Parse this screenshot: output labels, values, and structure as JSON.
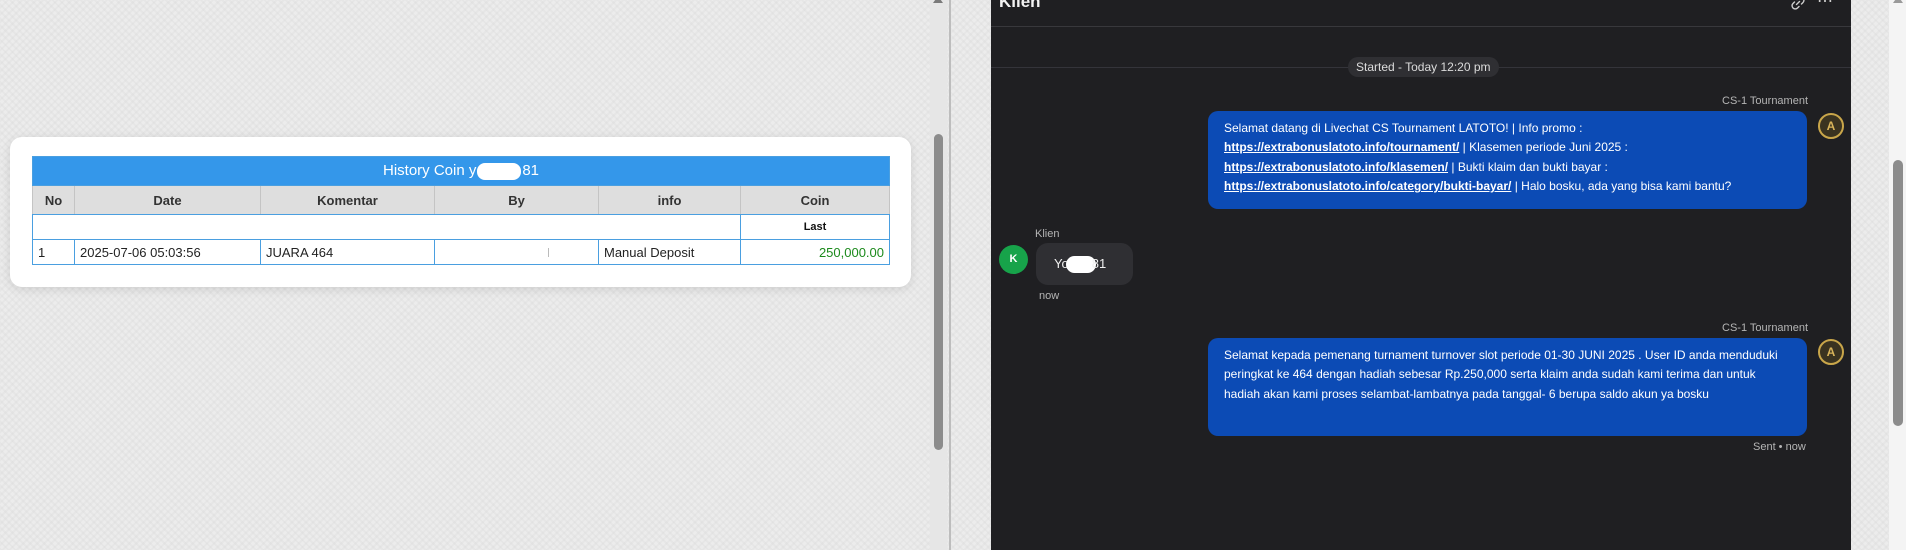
{
  "history": {
    "title_prefix": "History Coin y",
    "title_suffix": "81",
    "columns": [
      "No",
      "Date",
      "Komentar",
      "By",
      "info",
      "Coin"
    ],
    "last_label": "Last",
    "rows": [
      {
        "no": "1",
        "date": "2025-07-06 05:03:56",
        "komentar": "JUARA 464",
        "by": "",
        "info": "Manual Deposit",
        "coin": "250,000.00"
      }
    ]
  },
  "chat": {
    "title": "Klien",
    "started": "Started - Today 12:20 pm",
    "messages": [
      {
        "sender": "CS-1 Tournament",
        "avatar": "A",
        "p1": "Selamat datang di Livechat CS Tournament LATOTO! | Info promo :",
        "link1": "https://extrabonuslatoto.info/tournament/",
        "p2": " | Klasemen periode Juni 2025 :",
        "link2": "https://extrabonuslatoto.info/klasemen/",
        "p3": " | Bukti klaim dan bukti bayar :",
        "link3": "https://extrabonuslatoto.info/category/bukti-bayar/",
        "p4": " | Halo bosku, ada yang bisa kami bantu?"
      },
      {
        "sender": "CS-1 Tournament",
        "avatar": "A",
        "text": "Selamat kepada pemenang turnament turnover slot periode 01-30 JUNI 2025 . User ID anda menduduki peringkat ke 464 dengan hadiah sebesar Rp.250,000 serta klaim anda sudah kami terima dan untuk hadiah akan kami proses selambat-lambatnya pada tanggal- 6 berupa saldo akun ya bosku",
        "status": "Sent • now"
      }
    ],
    "client": {
      "name": "Klien",
      "avatar": "K",
      "msg_prefix": "Yo",
      "msg_suffix": "81",
      "time": "now"
    }
  },
  "colors": {
    "table_header": "#3497ea",
    "bubble_out": "#0c4bb5",
    "chat_bg": "#1f1f22",
    "coin_green": "#1c8a1c",
    "client_avatar": "#17a34a"
  },
  "icons": [
    "link-icon",
    "more-icon",
    "agent-avatar-icon"
  ]
}
